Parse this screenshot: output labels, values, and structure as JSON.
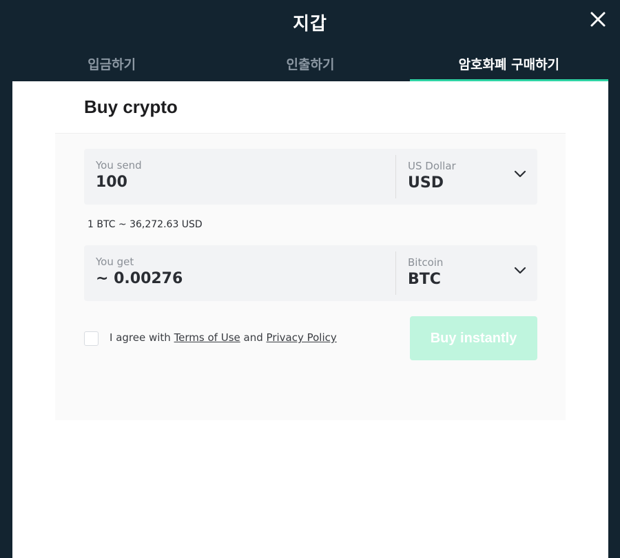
{
  "modal": {
    "title": "지갑"
  },
  "tabs": [
    {
      "label": "입금하기",
      "active": false
    },
    {
      "label": "인출하기",
      "active": false
    },
    {
      "label": "암호화폐 구매하기",
      "active": true
    }
  ],
  "card": {
    "title": "Buy crypto",
    "send": {
      "label": "You send",
      "value": "100",
      "currency_name": "US Dollar",
      "currency_code": "USD"
    },
    "rate": "1 BTC ~ 36,272.63 USD",
    "get": {
      "label": "You get",
      "value": "~ 0.00276",
      "currency_name": "Bitcoin",
      "currency_code": "BTC"
    },
    "agree": {
      "prefix": "I agree with ",
      "terms_link": "Terms of Use",
      "middle": " and ",
      "privacy_link": "Privacy Policy",
      "checked": false
    },
    "buy_button": "Buy instantly"
  },
  "colors": {
    "background": "#132430",
    "accent": "#2ed3a3",
    "button_disabled": "#bff5de"
  },
  "icons": {
    "close": "close-icon",
    "chevron": "chevron-down-icon"
  }
}
